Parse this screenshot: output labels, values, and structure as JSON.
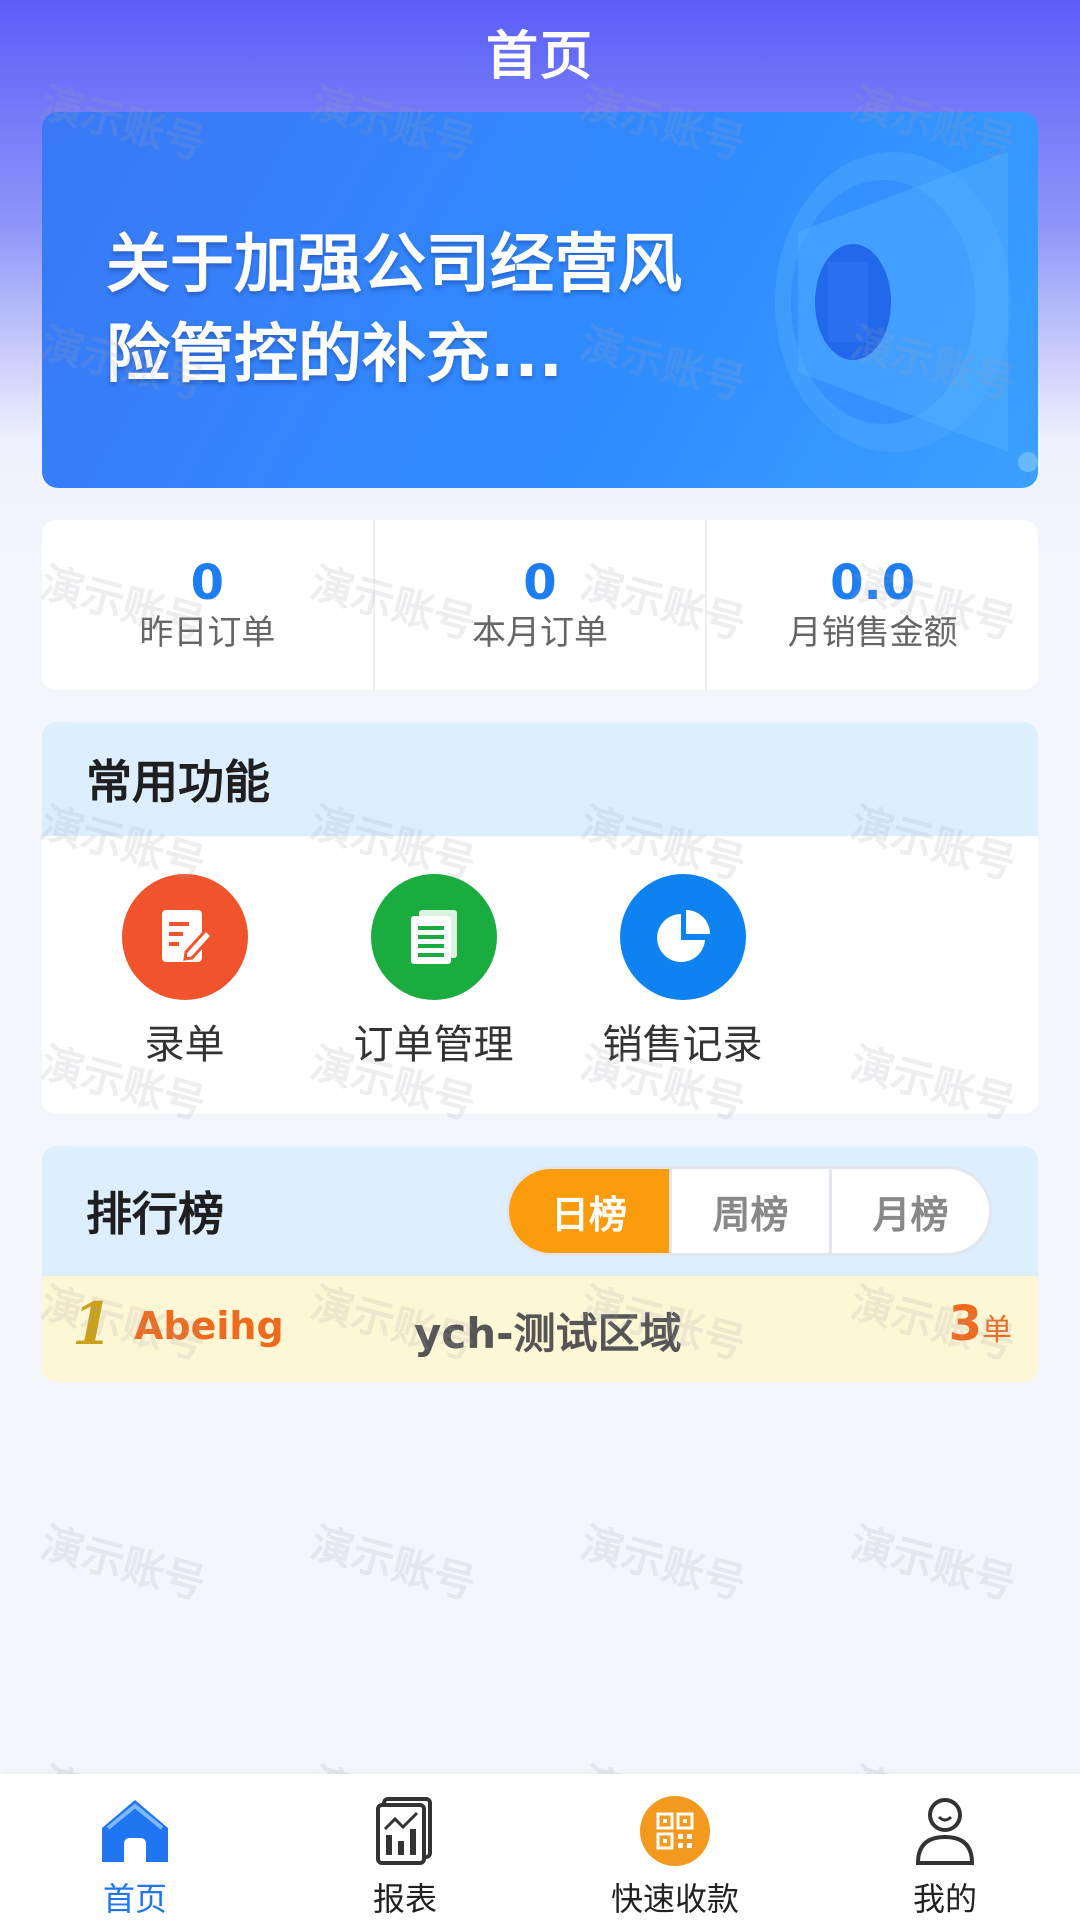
{
  "header": {
    "title": "首页"
  },
  "banner": {
    "text": "关于加强公司经营风险管控的补充..."
  },
  "stats": [
    {
      "value": "0",
      "label": "昨日订单"
    },
    {
      "value": "0",
      "label": "本月订单"
    },
    {
      "value": "0.0",
      "label": "月销售金额"
    }
  ],
  "functions": {
    "title": "常用功能",
    "items": [
      {
        "label": "录单",
        "icon": "edit-document-icon",
        "color": "#f1532c"
      },
      {
        "label": "订单管理",
        "icon": "document-list-icon",
        "color": "#1aac3f"
      },
      {
        "label": "销售记录",
        "icon": "pie-chart-icon",
        "color": "#0f82f2"
      }
    ]
  },
  "ranking": {
    "title": "排行榜",
    "tabs": [
      "日榜",
      "周榜",
      "月榜"
    ],
    "active_tab": "日榜",
    "rows": [
      {
        "rank": "1",
        "name": "Abeihg",
        "area": "ych-测试区域",
        "count": "3",
        "unit": "单"
      }
    ]
  },
  "watermark": "演示账号",
  "tabbar": {
    "items": [
      {
        "label": "首页",
        "icon": "home-icon",
        "active": true
      },
      {
        "label": "报表",
        "icon": "report-icon",
        "active": false
      },
      {
        "label": "快速收款",
        "icon": "qr-code-icon",
        "active": false
      },
      {
        "label": "我的",
        "icon": "user-icon",
        "active": false
      }
    ]
  },
  "colors": {
    "accent_blue": "#1d7df2",
    "tab_active_orange": "#fb9c0d",
    "rank_highlight": "#fef7d6"
  }
}
